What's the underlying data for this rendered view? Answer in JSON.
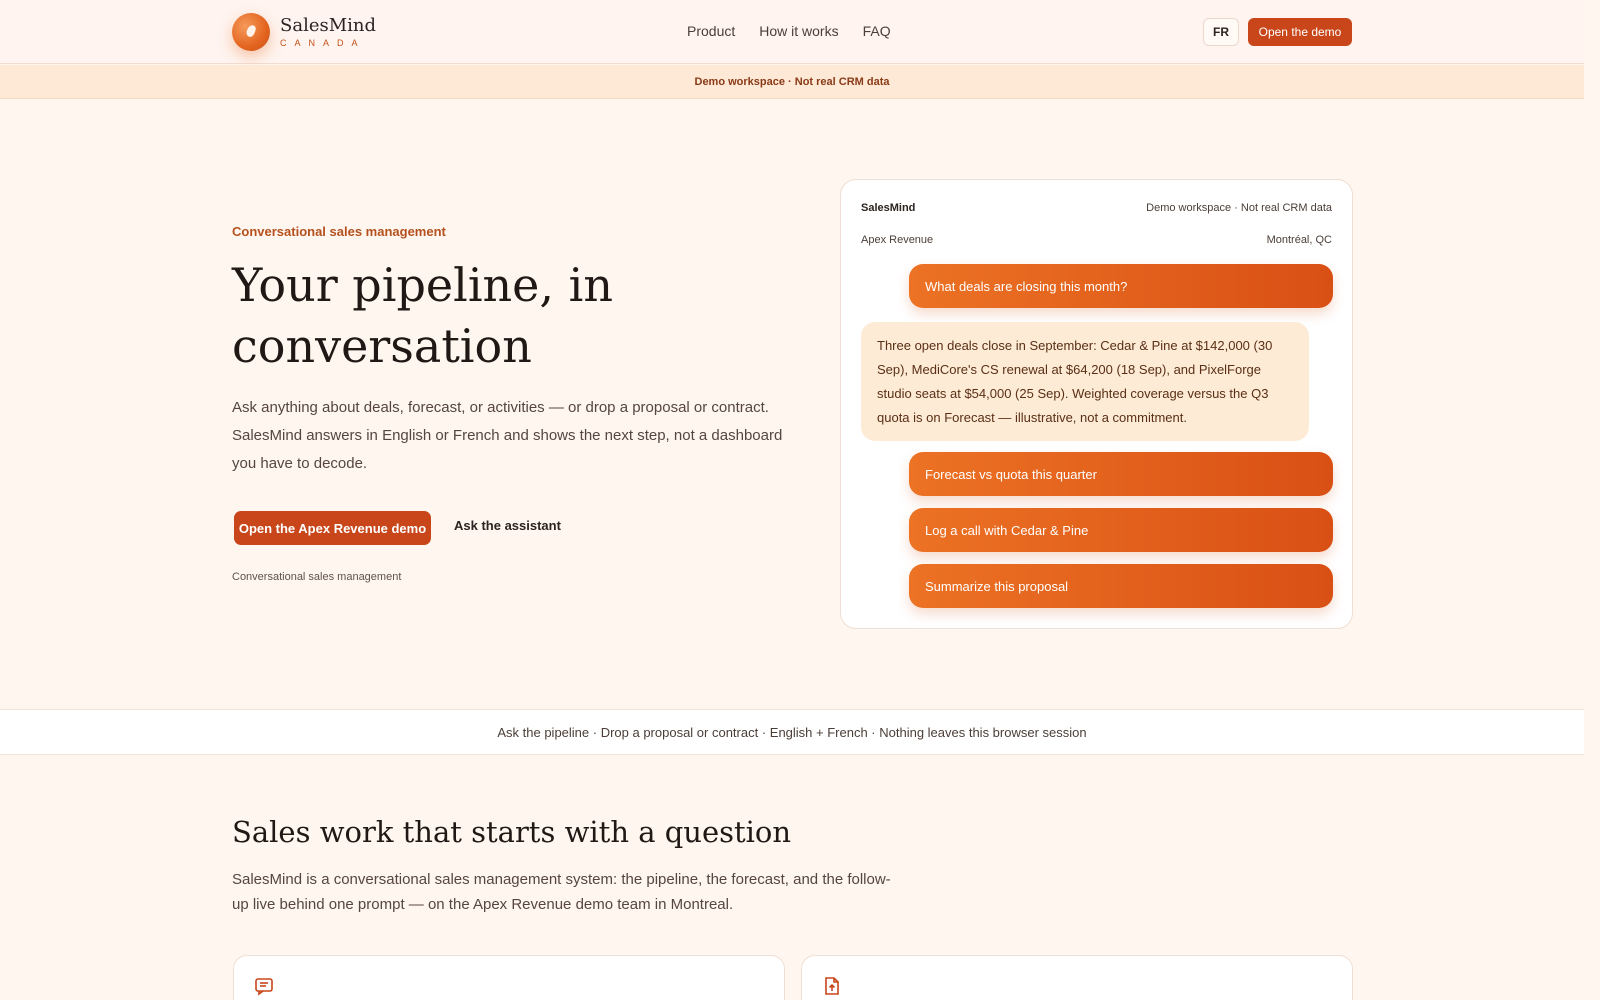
{
  "header": {
    "brand_name": "SalesMind",
    "brand_sub": "CANADA",
    "nav": [
      "Product",
      "How it works",
      "FAQ"
    ],
    "lang_button": "FR",
    "demo_button": "Open the demo"
  },
  "banner": "Demo workspace · Not real CRM data",
  "hero": {
    "eyebrow": "Conversational sales management",
    "title": "Your pipeline, in conversation",
    "body": "Ask anything about deals, forecast, or activities — or drop a proposal or contract. SalesMind answers in English or French and shows the next step, not a dashboard you have to decode.",
    "cta_primary": "Open the Apex Revenue demo",
    "cta_secondary": "Ask the assistant",
    "note": "Conversational sales management"
  },
  "chat": {
    "brand": "SalesMind",
    "workspace": "Demo workspace · Not real CRM data",
    "account": "Apex Revenue",
    "location": "Montréal, QC",
    "question": "What deals are closing this month?",
    "answer": "Three open deals close in September: Cedar & Pine at $142,000 (30 Sep), MediCore's CS renewal at $64,200 (18 Sep), and PixelForge studio seats at $54,000 (25 Sep). Weighted coverage versus the Q3 quota is on Forecast — illustrative, not a commitment.",
    "suggestions": [
      "Forecast vs quota this quarter",
      "Log a call with Cedar & Pine",
      "Summarize this proposal"
    ]
  },
  "strip": "Ask the pipeline · Drop a proposal or contract · English + French · Nothing leaves this browser session",
  "section": {
    "title": "Sales work that starts with a question",
    "body": "SalesMind is a conversational sales management system: the pipeline, the forecast, and the follow-up live behind one prompt — on the Apex Revenue demo team in Montreal."
  },
  "cards": [
    {
      "icon": "chat-lines-icon"
    },
    {
      "icon": "file-upload-icon"
    }
  ],
  "colors": {
    "accent": "#c8461a",
    "background": "#fff6ef",
    "answer_bg": "#fdebd6"
  }
}
